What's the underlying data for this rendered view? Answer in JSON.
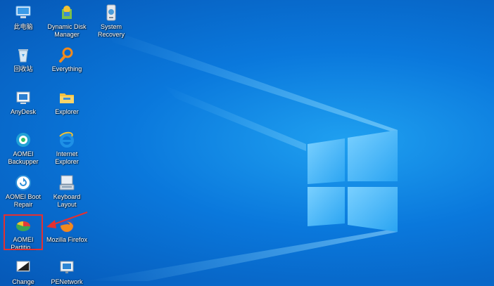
{
  "desktop_icons": [
    {
      "name": "this-pc",
      "label": "此电脑",
      "icon": "computer-icon"
    },
    {
      "name": "dynamic-disk-manager",
      "label": "Dynamic Disk Manager",
      "icon": "disk-manager-icon"
    },
    {
      "name": "system-recovery",
      "label": "System Recovery",
      "icon": "system-recovery-icon"
    },
    {
      "name": "recycle-bin",
      "label": "回收站",
      "icon": "recycle-bin-icon"
    },
    {
      "name": "everything",
      "label": "Everything",
      "icon": "magnifier-icon"
    },
    {
      "name": "anydesk",
      "label": "AnyDesk",
      "icon": "anydesk-icon"
    },
    {
      "name": "explorer",
      "label": "Explorer",
      "icon": "folder-icon"
    },
    {
      "name": "aomei-backupper",
      "label": "AOMEI Backupper",
      "icon": "backupper-icon"
    },
    {
      "name": "internet-explorer",
      "label": "Internet Explorer",
      "icon": "internet-explorer-icon"
    },
    {
      "name": "aomei-boot-repair",
      "label": "AOMEI Boot Repair",
      "icon": "boot-repair-icon"
    },
    {
      "name": "keyboard-layout",
      "label": "Keyboard Layout",
      "icon": "keyboard-icon"
    },
    {
      "name": "aomei-partition",
      "label": "AOMEI Partitio...",
      "icon": "partition-icon"
    },
    {
      "name": "mozilla-firefox",
      "label": "Mozilla Firefox",
      "icon": "firefox-icon"
    },
    {
      "name": "change",
      "label": "Change",
      "icon": "change-icon"
    },
    {
      "name": "penetwork",
      "label": "PENetwork",
      "icon": "network-icon"
    }
  ],
  "colors": {
    "highlight": "#e53030",
    "wallpaper": "#0a78dc"
  }
}
